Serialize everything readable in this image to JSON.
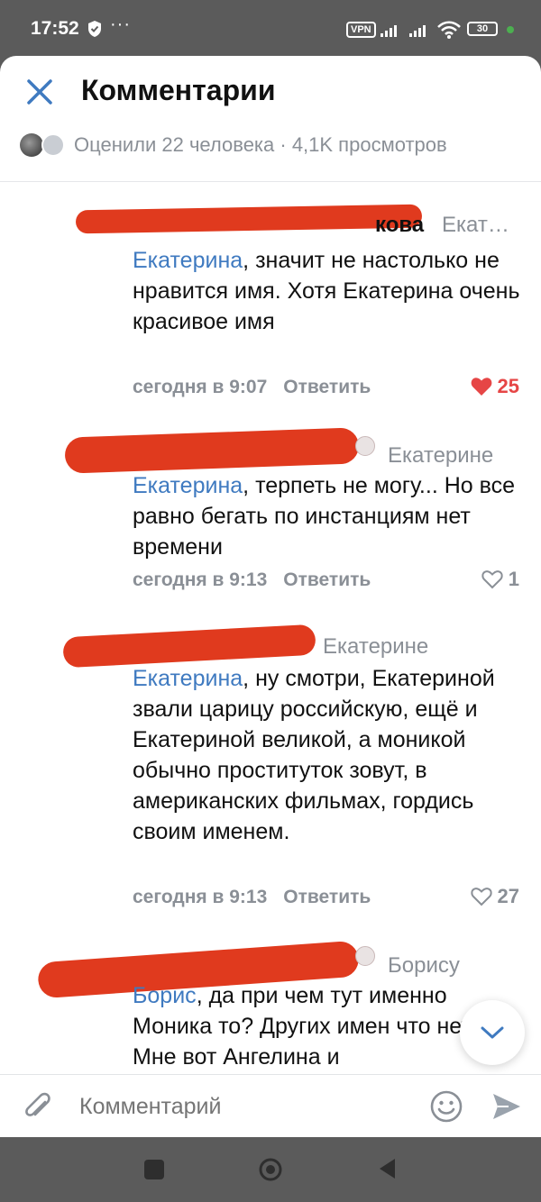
{
  "status_bar": {
    "time": "17:52",
    "vpn": "VPN",
    "battery": "30"
  },
  "header": {
    "title": "Комментарии",
    "likers_text": "Оценили 22 человека · 4,1K просмотров"
  },
  "comments": [
    {
      "author_visible": "кова",
      "reply_to": "Екат…",
      "mention": "Екатерина",
      "text": ",  значит не настолько не нравится имя. Хотя Екатерина очень красивое имя",
      "time": "сегодня в 9:07",
      "reply_label": "Ответить",
      "likes": "25",
      "liked": true
    },
    {
      "author_visible": "",
      "reply_to": "Екатерине",
      "mention": "Екатерина",
      "text": ", терпеть не могу... Но все равно бегать по инстанциям нет времени",
      "time": "сегодня в 9:13",
      "reply_label": "Ответить",
      "likes": "1",
      "liked": false
    },
    {
      "author_visible": "",
      "reply_to": "Екатерине",
      "mention": "Екатерина",
      "text": ", ну смотри, Екатериной звали царицу российскую, ещё и Екатериной великой, а моникой обычно проституток зовут, в американских фильмах, гордись своим именем.",
      "time": "сегодня в 9:13",
      "reply_label": "Ответить",
      "likes": "27",
      "liked": false
    },
    {
      "author_visible": "",
      "reply_to": "Борису",
      "mention": "Борис",
      "text": ", да при чем тут именно Моника то? Других имен что нет? Мне вот Ангелина и",
      "time": "",
      "reply_label": "",
      "likes": "",
      "liked": false
    }
  ],
  "composer": {
    "placeholder": "Комментарий"
  },
  "colors": {
    "accent": "#3f7ac0",
    "like_active": "#e64646",
    "redaction": "#e03a1e",
    "muted": "#8a8f96"
  }
}
